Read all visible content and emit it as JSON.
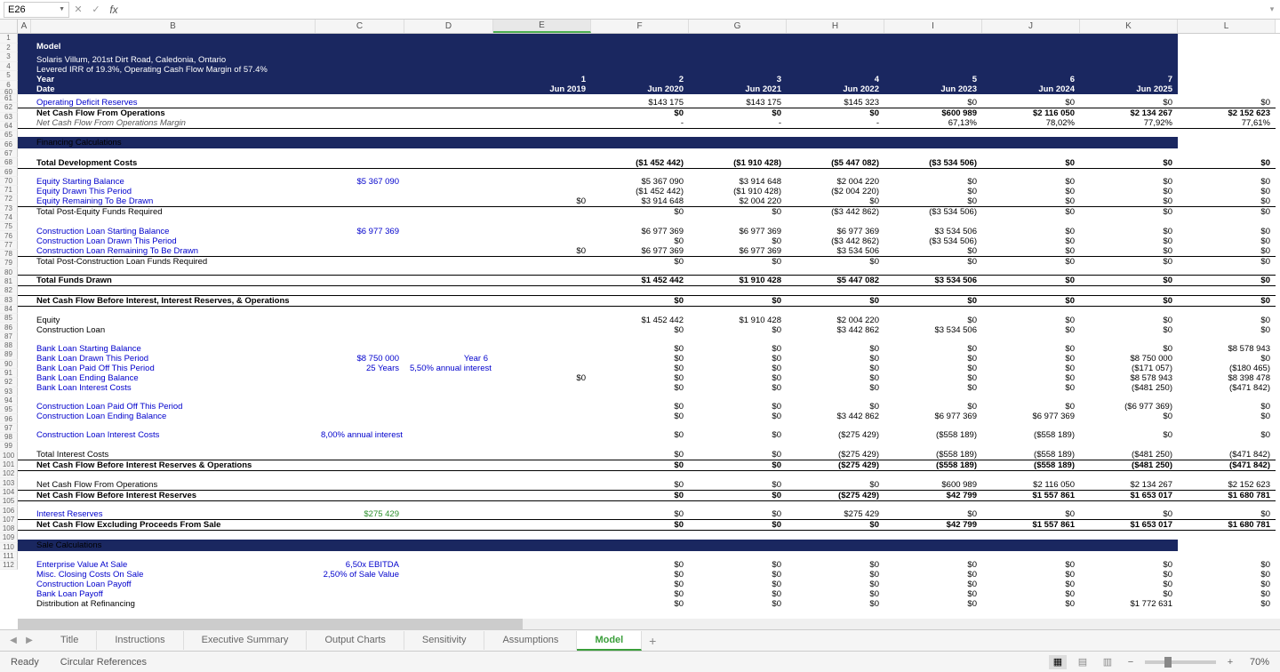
{
  "name_box": "E26",
  "formula": "",
  "columns": [
    "A",
    "B",
    "C",
    "D",
    "E",
    "F",
    "G",
    "H",
    "I",
    "J",
    "K",
    "L"
  ],
  "selected_col": "E",
  "model": {
    "title": "Model",
    "subtitle": "Solaris Villum, 201st Dirt Road, Caledonia, Ontario",
    "lev": "Levered IRR of 19.3%, Operating Cash Flow Margin of 57.4%",
    "year_label": "Year",
    "date_label": "Date",
    "years": [
      "1",
      "2",
      "3",
      "4",
      "5",
      "6",
      "7"
    ],
    "dates": [
      "Jun 2019",
      "Jun 2020",
      "Jun 2021",
      "Jun 2022",
      "Jun 2023",
      "Jun 2024",
      "Jun 2025"
    ]
  },
  "rows": [
    {
      "n": 61,
      "label": "Operating Deficit Reserves",
      "link": true,
      "v": [
        "$143 175",
        "$143 175",
        "$145 323",
        "$0",
        "$0",
        "$0",
        "$0"
      ]
    },
    {
      "n": 62,
      "label": "Net Cash Flow From Operations",
      "bold": true,
      "btop": true,
      "v": [
        "$0",
        "$0",
        "$0",
        "$600 989",
        "$2 116 050",
        "$2 134 267",
        "$2 152 623"
      ]
    },
    {
      "n": 63,
      "label": "Net Cash Flow From Operations Margin",
      "italic": true,
      "bbottom": true,
      "v": [
        "-",
        "-",
        "-",
        "67,13%",
        "78,02%",
        "77,92%",
        "77,61%"
      ]
    },
    {
      "n": 64,
      "label": ""
    },
    {
      "n": 65,
      "section": "Financing Calculations"
    },
    {
      "n": 66,
      "label": ""
    },
    {
      "n": 67,
      "label": "Total Development Costs",
      "bold": true,
      "bbottom": true,
      "v": [
        "($1 452 442)",
        "($1 910 428)",
        "($5 447 082)",
        "($3 534 506)",
        "$0",
        "$0",
        "$0"
      ]
    },
    {
      "n": 68,
      "label": ""
    },
    {
      "n": 69,
      "label": "Equity Starting Balance",
      "link": true,
      "c": "$5 367 090",
      "v": [
        "$5 367 090",
        "$3 914 648",
        "$2 004 220",
        "$0",
        "$0",
        "$0",
        "$0"
      ]
    },
    {
      "n": 70,
      "label": "Equity Drawn This Period",
      "link": true,
      "v": [
        "($1 452 442)",
        "($1 910 428)",
        "($2 004 220)",
        "$0",
        "$0",
        "$0",
        "$0"
      ]
    },
    {
      "n": 71,
      "label": "Equity Remaining To Be Drawn",
      "link": true,
      "e": "$0",
      "v": [
        "$3 914 648",
        "$2 004 220",
        "$0",
        "$0",
        "$0",
        "$0",
        "$0"
      ]
    },
    {
      "n": 72,
      "label": "Total Post-Equity Funds Required",
      "btop": true,
      "v": [
        "$0",
        "$0",
        "($3 442 862)",
        "($3 534 506)",
        "$0",
        "$0",
        "$0"
      ]
    },
    {
      "n": 73,
      "label": ""
    },
    {
      "n": 74,
      "label": "Construction Loan Starting Balance",
      "link": true,
      "c": "$6 977 369",
      "v": [
        "$6 977 369",
        "$6 977 369",
        "$6 977 369",
        "$3 534 506",
        "$0",
        "$0",
        "$0"
      ]
    },
    {
      "n": 75,
      "label": "Construction Loan Drawn This Period",
      "link": true,
      "v": [
        "$0",
        "$0",
        "($3 442 862)",
        "($3 534 506)",
        "$0",
        "$0",
        "$0"
      ]
    },
    {
      "n": 76,
      "label": "Construction Loan Remaining To Be Drawn",
      "link": true,
      "e": "$0",
      "v": [
        "$6 977 369",
        "$6 977 369",
        "$3 534 506",
        "$0",
        "$0",
        "$0",
        "$0"
      ]
    },
    {
      "n": 77,
      "label": "Total Post-Construction Loan Funds Required",
      "btop": true,
      "v": [
        "$0",
        "$0",
        "$0",
        "$0",
        "$0",
        "$0",
        "$0"
      ]
    },
    {
      "n": 78,
      "label": ""
    },
    {
      "n": 79,
      "label": "Total Funds Drawn",
      "bold": true,
      "btop": true,
      "bbottom": true,
      "v": [
        "$1 452 442",
        "$1 910 428",
        "$5 447 082",
        "$3 534 506",
        "$0",
        "$0",
        "$0"
      ]
    },
    {
      "n": 80,
      "label": ""
    },
    {
      "n": 81,
      "label": "Net Cash Flow Before Interest, Interest Reserves, & Operations",
      "bold": true,
      "btop": true,
      "bbottom": true,
      "v": [
        "$0",
        "$0",
        "$0",
        "$0",
        "$0",
        "$0",
        "$0"
      ]
    },
    {
      "n": 82,
      "label": ""
    },
    {
      "n": 83,
      "label": "Equity",
      "v": [
        "$1 452 442",
        "$1 910 428",
        "$2 004 220",
        "$0",
        "$0",
        "$0",
        "$0"
      ]
    },
    {
      "n": 84,
      "label": "Construction Loan",
      "v": [
        "$0",
        "$0",
        "$3 442 862",
        "$3 534 506",
        "$0",
        "$0",
        "$0"
      ]
    },
    {
      "n": 85,
      "label": ""
    },
    {
      "n": 86,
      "label": "Bank Loan Starting Balance",
      "link": true,
      "v": [
        "$0",
        "$0",
        "$0",
        "$0",
        "$0",
        "$0",
        "$8 578 943"
      ]
    },
    {
      "n": 87,
      "label": "Bank Loan Drawn This Period",
      "link": true,
      "c": "$8 750 000",
      "d": "Year 6",
      "v": [
        "$0",
        "$0",
        "$0",
        "$0",
        "$0",
        "$8 750 000",
        "$0"
      ]
    },
    {
      "n": 88,
      "label": "Bank Loan Paid Off This Period",
      "link": true,
      "c": "25 Years",
      "d": "5,50% annual interest",
      "v": [
        "$0",
        "$0",
        "$0",
        "$0",
        "$0",
        "($171 057)",
        "($180 465)"
      ]
    },
    {
      "n": 89,
      "label": "Bank Loan Ending Balance",
      "link": true,
      "e": "$0",
      "v": [
        "$0",
        "$0",
        "$0",
        "$0",
        "$0",
        "$8 578 943",
        "$8 398 478"
      ]
    },
    {
      "n": 90,
      "label": "Bank Loan Interest Costs",
      "link": true,
      "v": [
        "$0",
        "$0",
        "$0",
        "$0",
        "$0",
        "($481 250)",
        "($471 842)"
      ]
    },
    {
      "n": 91,
      "label": ""
    },
    {
      "n": 92,
      "label": "Construction Loan Paid Off This Period",
      "link": true,
      "v": [
        "$0",
        "$0",
        "$0",
        "$0",
        "$0",
        "($6 977 369)",
        "$0"
      ]
    },
    {
      "n": 93,
      "label": "Construction Loan Ending Balance",
      "link": true,
      "v": [
        "$0",
        "$0",
        "$3 442 862",
        "$6 977 369",
        "$6 977 369",
        "$0",
        "$0"
      ]
    },
    {
      "n": 94,
      "label": ""
    },
    {
      "n": 95,
      "label": "Construction Loan Interest Costs",
      "link": true,
      "c": "8,00% annual interest",
      "v": [
        "$0",
        "$0",
        "($275 429)",
        "($558 189)",
        "($558 189)",
        "$0",
        "$0"
      ]
    },
    {
      "n": 96,
      "label": ""
    },
    {
      "n": 97,
      "label": "Total Interest Costs",
      "v": [
        "$0",
        "$0",
        "($275 429)",
        "($558 189)",
        "($558 189)",
        "($481 250)",
        "($471 842)"
      ]
    },
    {
      "n": 98,
      "label": "Net Cash Flow Before Interest Reserves & Operations",
      "bold": true,
      "btop": true,
      "bbottom": true,
      "v": [
        "$0",
        "$0",
        "($275 429)",
        "($558 189)",
        "($558 189)",
        "($481 250)",
        "($471 842)"
      ]
    },
    {
      "n": 99,
      "label": ""
    },
    {
      "n": 100,
      "label": "Net Cash Flow From Operations",
      "v": [
        "$0",
        "$0",
        "$0",
        "$600 989",
        "$2 116 050",
        "$2 134 267",
        "$2 152 623"
      ]
    },
    {
      "n": 101,
      "label": "Net Cash Flow Before Interest Reserves",
      "bold": true,
      "btop": true,
      "bbottom": true,
      "v": [
        "$0",
        "$0",
        "($275 429)",
        "$42 799",
        "$1 557 861",
        "$1 653 017",
        "$1 680 781"
      ]
    },
    {
      "n": 102,
      "label": ""
    },
    {
      "n": 103,
      "label": "Interest Reserves",
      "link": true,
      "c": "$275 429",
      "green": true,
      "v": [
        "$0",
        "$0",
        "$275 429",
        "$0",
        "$0",
        "$0",
        "$0"
      ]
    },
    {
      "n": 104,
      "label": "Net Cash Flow Excluding Proceeds From Sale",
      "bold": true,
      "btop": true,
      "bbottom": true,
      "v": [
        "$0",
        "$0",
        "$0",
        "$42 799",
        "$1 557 861",
        "$1 653 017",
        "$1 680 781"
      ]
    },
    {
      "n": 105,
      "label": ""
    },
    {
      "n": 106,
      "section": "Sale Calculations"
    },
    {
      "n": 107,
      "label": ""
    },
    {
      "n": 108,
      "label": "Enterprise Value At Sale",
      "link": true,
      "c": "6,50x EBITDA",
      "v": [
        "$0",
        "$0",
        "$0",
        "$0",
        "$0",
        "$0",
        "$0"
      ]
    },
    {
      "n": 109,
      "label": "Misc. Closing Costs On Sale",
      "link": true,
      "c": "2,50% of Sale Value",
      "v": [
        "$0",
        "$0",
        "$0",
        "$0",
        "$0",
        "$0",
        "$0"
      ]
    },
    {
      "n": 110,
      "label": "Construction Loan Payoff",
      "link": true,
      "v": [
        "$0",
        "$0",
        "$0",
        "$0",
        "$0",
        "$0",
        "$0"
      ]
    },
    {
      "n": 111,
      "label": "Bank Loan Payoff",
      "link": true,
      "v": [
        "$0",
        "$0",
        "$0",
        "$0",
        "$0",
        "$0",
        "$0"
      ]
    },
    {
      "n": 112,
      "label": "Distribution at Refinancing",
      "v": [
        "$0",
        "$0",
        "$0",
        "$0",
        "$0",
        "$1 772 631",
        "$0"
      ]
    }
  ],
  "tabs": [
    "Title",
    "Instructions",
    "Executive Summary",
    "Output Charts",
    "Sensitivity",
    "Assumptions",
    "Model"
  ],
  "active_tab": "Model",
  "status": {
    "ready": "Ready",
    "circ": "Circular References",
    "zoom": "70%"
  }
}
